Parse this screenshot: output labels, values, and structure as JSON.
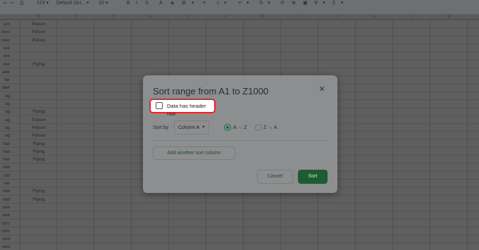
{
  "toolbar": {
    "items": [
      "⇦",
      "⇨",
      "⎙",
      "123 ▾",
      "Default (Ari... ▾",
      "10 ▾",
      "B",
      "I",
      "S",
      "A",
      "◈",
      "⊞",
      "▾",
      "≡",
      "⊥",
      "▾",
      "↵",
      "▾",
      "↻",
      "▾",
      "⊖",
      "⊕",
      "▣",
      "∀",
      "▾",
      "Σ",
      "▾"
    ]
  },
  "sheet": {
    "column_headers": [
      "B",
      "C",
      "D",
      "E",
      "F",
      "G",
      "H",
      "I",
      "J",
      "K",
      "L",
      "M",
      "N"
    ],
    "col_a_cells": [
      "um",
      "mes",
      "mes",
      "ore",
      "ore",
      "ore",
      "ade",
      "ter",
      "ater",
      "ug",
      "ug",
      "ug",
      "ug",
      "ug",
      "ug",
      "mal",
      "mal",
      "mal",
      "mal",
      "nal",
      "nal",
      "mal",
      "mal",
      "ase",
      "ase",
      "ctric",
      "ctric",
      "und",
      "und"
    ],
    "col_b_cells": [
      "Poison",
      "Poison",
      "Poison",
      "",
      "",
      "Flying",
      "",
      "",
      "",
      "",
      "",
      "Flying",
      "Poison",
      "Poison",
      "Poison",
      "Flying",
      "Flying",
      "Flying",
      "",
      "",
      "",
      "Flying",
      "Flying",
      "",
      "",
      "",
      "",
      "",
      ""
    ]
  },
  "dialog": {
    "title": "Sort range from A1 to Z1000",
    "close_icon": "close-icon",
    "header_row_label": "Data has header row",
    "header_row_checked": false,
    "sort_by_label": "Sort by",
    "column_value": "Column A",
    "az_label": "A → Z",
    "za_label": "Z → A",
    "selected_order": "A → Z",
    "add_column_label": "Add another sort column",
    "cancel_label": "Cancel",
    "sort_label": "Sort"
  },
  "colors": {
    "accent_green": "#1d5c32",
    "highlight_red": "#d72b2b",
    "overlay": "#5f5f5f"
  }
}
